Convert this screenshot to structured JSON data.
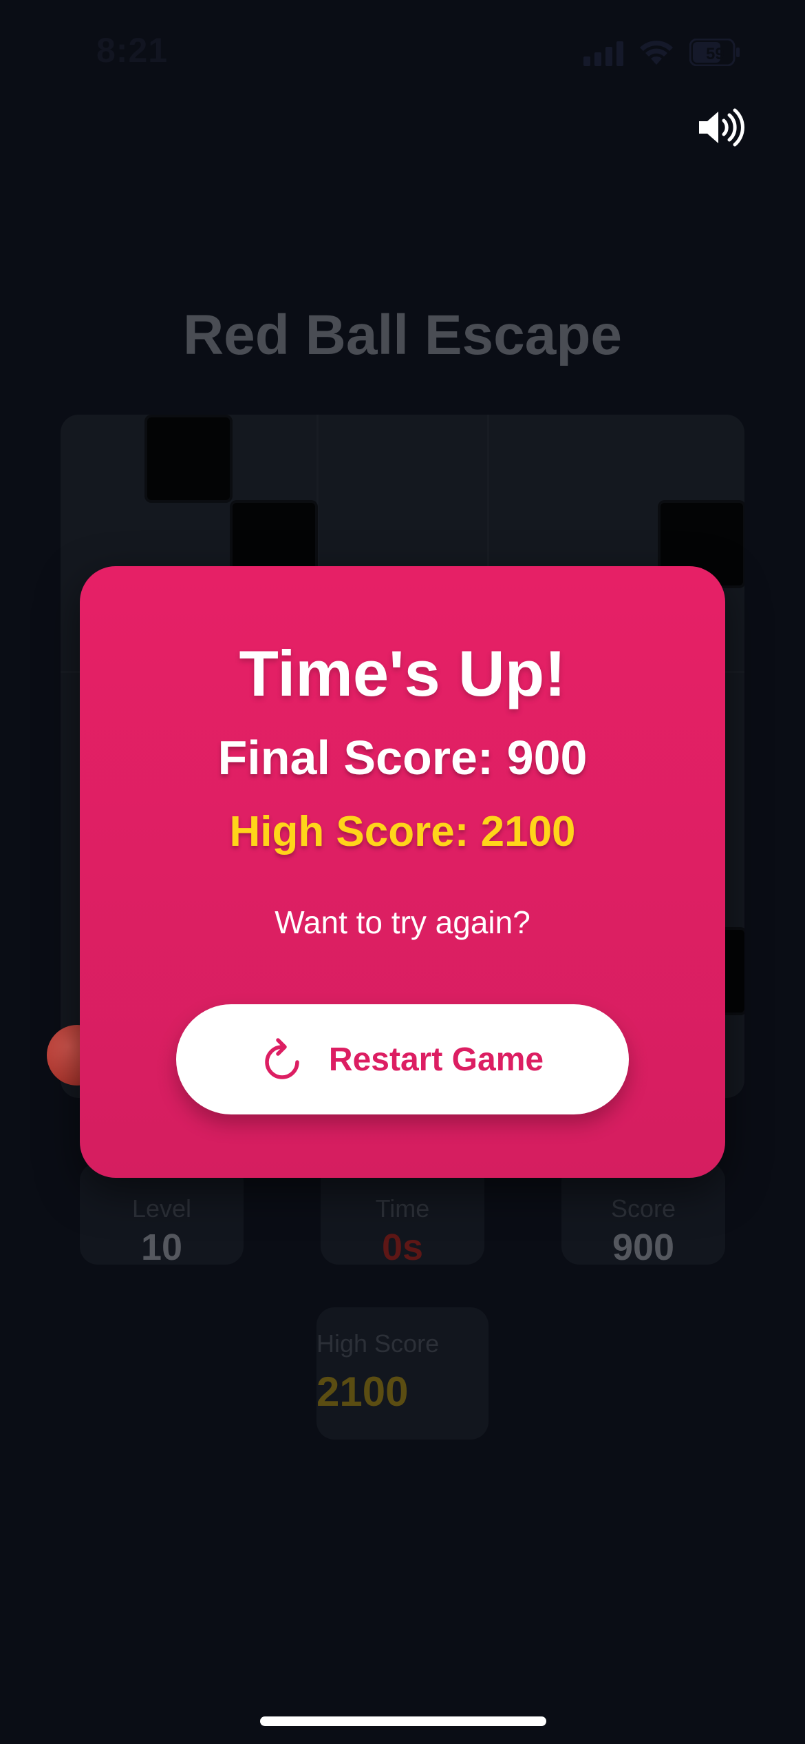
{
  "status_bar": {
    "time": "8:21",
    "battery": "59"
  },
  "game": {
    "title": "Red Ball Escape",
    "stats": {
      "level_label": "Level",
      "level_value": "10",
      "time_label": "Time",
      "time_value": "0s",
      "score_label": "Score",
      "score_value": "900"
    },
    "high_score_label": "High Score",
    "high_score_value": "2100"
  },
  "modal": {
    "title": "Time's Up!",
    "final_score": "Final Score: 900",
    "high_score": "High Score: 2100",
    "prompt": "Want to try again?",
    "restart_label": "Restart Game"
  },
  "colors": {
    "modal_bg": "#e62066",
    "accent": "#dc1e62",
    "high_score_text": "#ffd51a",
    "background": "#0a0d15"
  },
  "icons": {
    "sound": "speaker-volume-icon",
    "restart": "refresh-icon"
  }
}
